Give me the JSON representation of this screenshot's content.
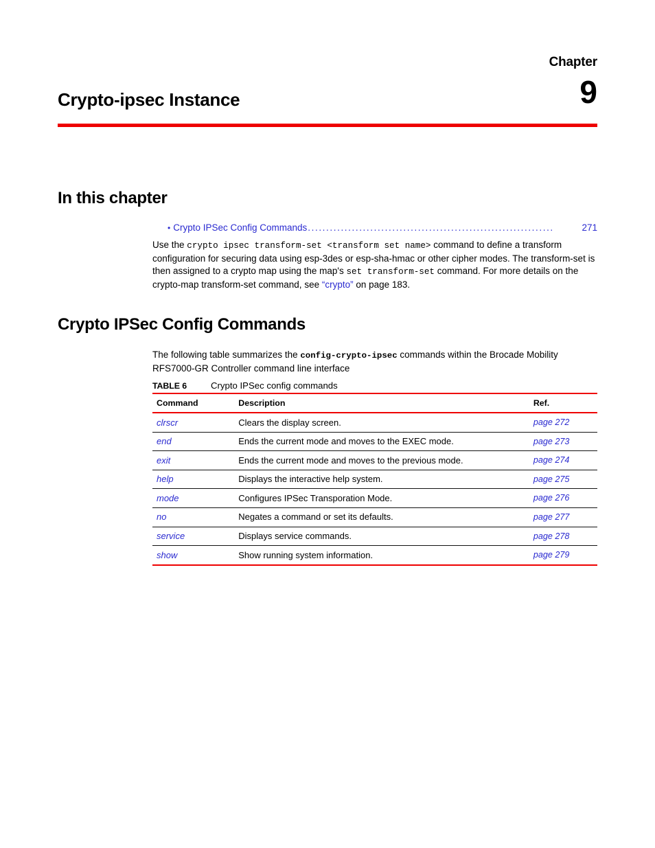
{
  "chapter": {
    "label": "Chapter",
    "number": "9",
    "title": "Crypto-ipsec Instance"
  },
  "sections": {
    "in_this_chapter_heading": "In this chapter",
    "crypto_ipsec_heading": "Crypto IPSec Config Commands"
  },
  "toc": {
    "bullet": "•",
    "entry_label": "Crypto IPSec Config Commands",
    "leader": "...................................................................",
    "page": "271"
  },
  "intro_paragraph": {
    "part1": "Use the ",
    "code1": "crypto ipsec transform-set <transform set name>",
    "part2": " command to define a transform configuration for securing data using esp-3des or esp-sha-hmac or other cipher modes. The transform-set is then assigned to a crypto map using the map's ",
    "code2": "set transform-set",
    "part3": " command. For more details on the crypto-map transform-set command, see ",
    "link_text": "“crypto”",
    "part4": " on page 183."
  },
  "table_intro": {
    "part1": "The following table summarizes the ",
    "code1": "config-crypto-ipsec",
    "part2": " commands within the Brocade Mobility RFS7000-GR Controller command line interface"
  },
  "table": {
    "caption_number": "TABLE 6",
    "caption_title": "Crypto IPSec config commands",
    "headers": {
      "command": "Command",
      "description": "Description",
      "ref": "Ref."
    },
    "rows": [
      {
        "command": "clrscr",
        "description": "Clears the display screen.",
        "ref": "page 272"
      },
      {
        "command": "end",
        "description": "Ends the current mode and moves to the EXEC mode.",
        "ref": "page 273"
      },
      {
        "command": "exit",
        "description": "Ends the current mode and moves to the previous mode.",
        "ref": "page 274"
      },
      {
        "command": "help",
        "description": "Displays the interactive help system.",
        "ref": "page 275"
      },
      {
        "command": "mode",
        "description": "Configures IPSec Transporation Mode.",
        "ref": "page 276"
      },
      {
        "command": "no",
        "description": "Negates a command or set its defaults.",
        "ref": "page 277"
      },
      {
        "command": "service",
        "description": "Displays service commands.",
        "ref": "page 278"
      },
      {
        "command": "show",
        "description": "Show running system information.",
        "ref": "page 279"
      }
    ]
  },
  "colors": {
    "accent_red": "#ee0000",
    "link_blue": "#2a2ad0",
    "text_black": "#000000"
  }
}
